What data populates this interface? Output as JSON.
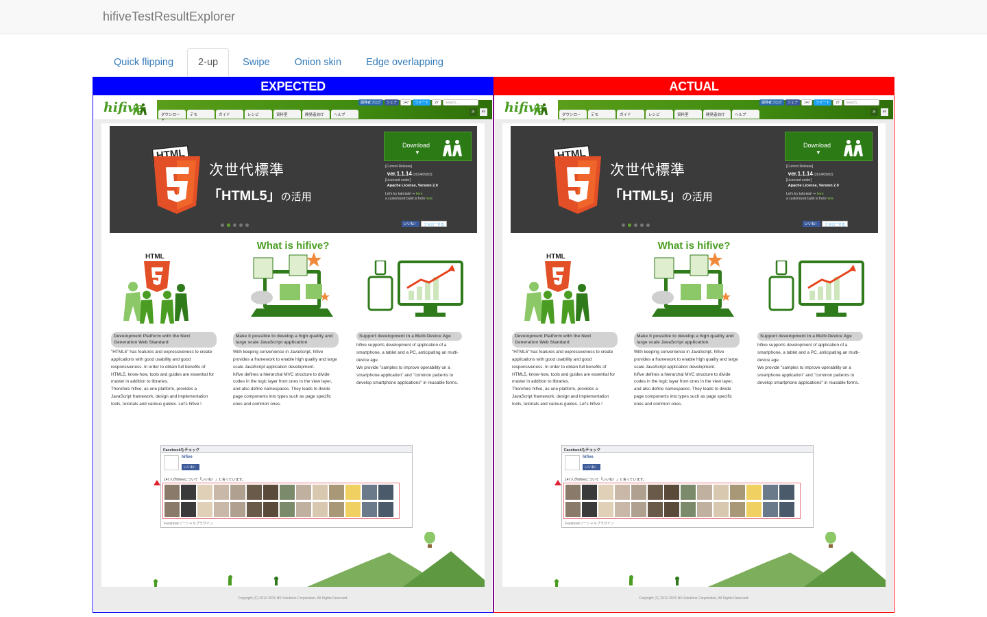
{
  "app": {
    "title": "hifiveTestResultExplorer"
  },
  "tabs": [
    {
      "label": "Quick flipping",
      "active": false
    },
    {
      "label": "2-up",
      "active": true
    },
    {
      "label": "Swipe",
      "active": false
    },
    {
      "label": "Onion skin",
      "active": false
    },
    {
      "label": "Edge overlapping",
      "active": false
    }
  ],
  "panels": {
    "expected": {
      "label": "EXPECTED",
      "color": "#0000ff"
    },
    "actual": {
      "label": "ACTUAL",
      "color": "#ff0000"
    }
  },
  "site": {
    "logo": "hifive",
    "nav": [
      "ダウンロード",
      "デモ",
      "ガイド",
      "レシピ",
      "資料室",
      "開発者向け",
      "ヘルプ"
    ],
    "social": {
      "blog": "開発者ブログ",
      "share": "シェア",
      "share_count": "147",
      "tweet": "ツイート",
      "tweet_count": "27",
      "search_placeholder": "search..."
    },
    "lang": {
      "ja": "ja",
      "en": "en"
    },
    "hero": {
      "badge": "HTML",
      "line1": "次世代標準",
      "line2_main": "「HTML5」",
      "line2_tail": "の活用",
      "download": "Download",
      "current_release": "[Current Release]",
      "version": "ver.1.1.14",
      "version_date": "(2014/09/02)",
      "licensed": "[Licensed under]",
      "license": "Apache License, Version 2.0",
      "tutorial": "Let's try tutorials! ⇒",
      "tutorial_link": "here",
      "custom_build": "a customized build is from",
      "custom_link": "here",
      "like": "いいね！",
      "follow": "フォローする"
    },
    "what": "What is hifive?",
    "features": [
      {
        "title": "Development Platform with the Next Generation Web Standard",
        "paragraphs": [
          "\"HTML5\" has features and expressiveness to create applications with good usability and good responsiveness. In order to obtain full benefits of HTML5, know-how, tools and guides are essential for master in addition to libraries.",
          "Therefore hifive, as one platform, provides a JavaScript framework, design and implementation tools, tutorials and various guides. Let's hifive !"
        ]
      },
      {
        "title": "Make it possible to develop a high quality and large scale JavaScript application",
        "paragraphs": [
          "With keeping convenience in JavaScript, hifive provides a framework to enable high quality and large scale JavaScript application development.",
          "hifive defines a hierarchal MVC structure to divide codes in the logic layer from ones in the view layer, and also define namespaces. They leads to divide page components into types such as page specific ones and common ones."
        ]
      },
      {
        "title": "Support development in a Multi-Device Age",
        "paragraphs": [
          "hifive supports development of application of a smartphone, a tablet and a PC, anticipating an multi-device age.",
          "We provide \"samples to improve operability on a smartphone application\" and \"common patterns to develop smartphone applications\" in reusable forms."
        ]
      }
    ],
    "facebook": {
      "header": "Facebookもチェック",
      "page_name": "hifive",
      "like": "いいね！",
      "count": "147人がhifiveについて「いいね！」と言っています。",
      "plugin": "Facebookソーシャルプラグイン"
    },
    "footer": "Copyright (C) 2012-2015 NS Solutions Corporation, All Rights Reserved."
  }
}
